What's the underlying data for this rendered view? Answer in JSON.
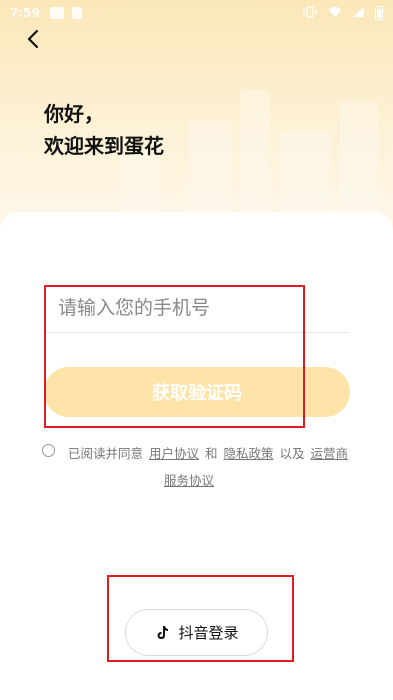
{
  "status_bar": {
    "time": "7:59"
  },
  "greeting": {
    "line1": "你好，",
    "line2": "欢迎来到蛋花"
  },
  "phone_input": {
    "placeholder": "请输入您的手机号",
    "value": ""
  },
  "get_code_button": {
    "label": "获取验证码"
  },
  "agreement": {
    "prefix": "已阅读并同意",
    "user_agreement": "用户协议",
    "and": "和",
    "privacy_policy": "隐私政策",
    "and_also": "以及",
    "operator": "运营商",
    "operator_service": "服务协议"
  },
  "douyin_login": {
    "label": "抖音登录"
  },
  "colors": {
    "accent_button": "#fee4a8",
    "highlight_box": "#e11b22",
    "bg_top": "#fbe7b8"
  }
}
